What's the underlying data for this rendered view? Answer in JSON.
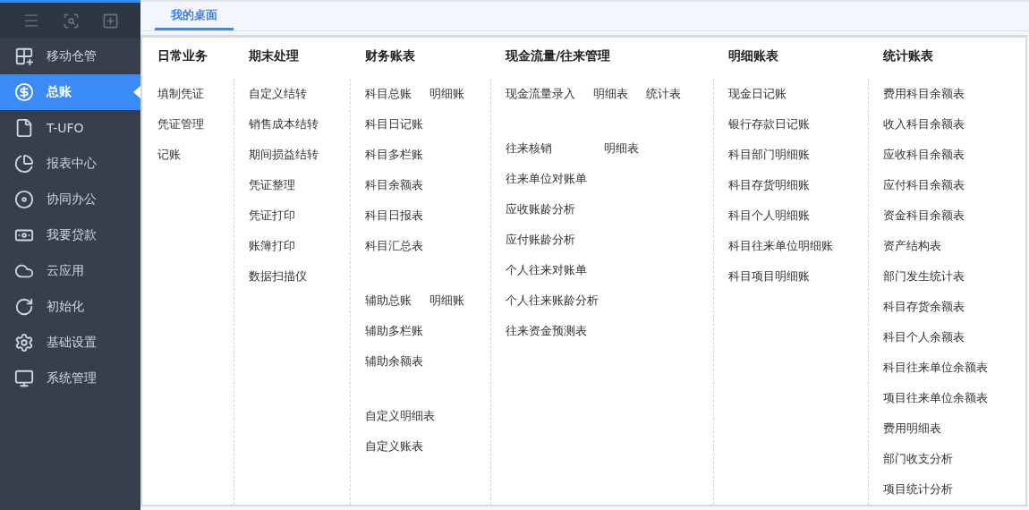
{
  "sidebar": {
    "items": [
      {
        "label": "移动仓管",
        "selected": false
      },
      {
        "label": "总账",
        "selected": true
      },
      {
        "label": "T-UFO",
        "selected": false
      },
      {
        "label": "报表中心",
        "selected": false
      },
      {
        "label": "协同办公",
        "selected": false
      },
      {
        "label": "我要贷款",
        "selected": false
      },
      {
        "label": "云应用",
        "selected": false
      },
      {
        "label": "初始化",
        "selected": false
      },
      {
        "label": "基础设置",
        "selected": false
      },
      {
        "label": "系统管理",
        "selected": false
      }
    ]
  },
  "tabs": [
    {
      "label": "我的桌面",
      "selected": true
    }
  ],
  "columns": [
    {
      "title": "日常业务",
      "groups": [
        [
          [
            "填制凭证"
          ],
          [
            "凭证管理"
          ],
          [
            "记账"
          ]
        ]
      ]
    },
    {
      "title": "期末处理",
      "groups": [
        [
          [
            "自定义结转"
          ],
          [
            "销售成本结转"
          ],
          [
            "期间损益结转"
          ],
          [
            "凭证整理"
          ],
          [
            "凭证打印"
          ],
          [
            "账簿打印"
          ],
          [
            "数据扫描仪"
          ]
        ]
      ]
    },
    {
      "title": "财务账表",
      "groups": [
        [
          [
            "科目总账",
            "明细账"
          ],
          [
            "科目日记账"
          ],
          [
            "科目多栏账"
          ],
          [
            "科目余额表"
          ],
          [
            "科目日报表"
          ],
          [
            "科目汇总表"
          ]
        ],
        [
          [
            "辅助总账",
            "明细账"
          ],
          [
            "辅助多栏账"
          ],
          [
            "辅助余额表"
          ]
        ],
        [
          [
            "自定义明细表"
          ],
          [
            "自定义账表"
          ]
        ]
      ]
    },
    {
      "title": "现金流量/往来管理",
      "groups": [
        [
          [
            "现金流量录入",
            "明细表",
            "统计表"
          ]
        ],
        [
          [
            "往来核销",
            "明细表"
          ],
          [
            "往来单位对账单"
          ],
          [
            "应收账龄分析"
          ],
          [
            "应付账龄分析"
          ],
          [
            "个人往来对账单"
          ],
          [
            "个人往来账龄分析"
          ],
          [
            "往来资金预测表"
          ]
        ]
      ]
    },
    {
      "title": "明细账表",
      "groups": [
        [
          [
            "现金日记账"
          ],
          [
            "银行存款日记账"
          ],
          [
            "科目部门明细账"
          ],
          [
            "科目存货明细账"
          ],
          [
            "科目个人明细账"
          ],
          [
            "科目往来单位明细账"
          ],
          [
            "科目项目明细账"
          ]
        ]
      ]
    },
    {
      "title": "统计账表",
      "groups": [
        [
          [
            "费用科目余额表"
          ],
          [
            "收入科目余额表"
          ],
          [
            "应收科目余额表"
          ],
          [
            "应付科目余额表"
          ],
          [
            "资金科目余额表"
          ],
          [
            "资产结构表"
          ],
          [
            "部门发生统计表"
          ],
          [
            "科目存货余额表"
          ],
          [
            "科目个人余额表"
          ],
          [
            "科目往来单位余额表"
          ],
          [
            "项目往来单位余额表"
          ],
          [
            "费用明细表"
          ],
          [
            "部门收支分析"
          ],
          [
            "项目统计分析"
          ]
        ]
      ]
    }
  ]
}
